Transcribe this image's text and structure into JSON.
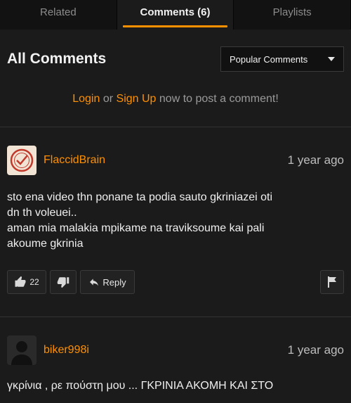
{
  "tabs": [
    {
      "label": "Related",
      "active": false
    },
    {
      "label": "Comments (6)",
      "active": true
    },
    {
      "label": "Playlists",
      "active": false
    }
  ],
  "header": {
    "title": "All Comments",
    "sort_label": "Popular Comments"
  },
  "login_prompt": {
    "login": "Login",
    "or": "or",
    "signup": "Sign Up",
    "rest": "now to post a comment!"
  },
  "comments": [
    {
      "username": "FlaccidBrain",
      "age": "1 year ago",
      "lines": [
        "sto ena video thn ponane ta podia sauto gkriniazei oti",
        "dn th voleuei..",
        "aman mia malakia mpikame na traviksoume kai pali",
        "akoume gkrinia"
      ],
      "likes": "22",
      "reply_label": "Reply"
    },
    {
      "username": "biker998i",
      "age": "1 year ago",
      "lines": [
        "γκρίνια , ρε πούστη μου ... ΓΚΡΙΝΙΑ ΑΚΟΜΗ ΚΑΙ ΣΤΟ"
      ]
    }
  ],
  "colors": {
    "accent": "#ff9000",
    "background": "#1b1b1b"
  },
  "icons": [
    "thumbs-up-icon",
    "thumbs-down-icon",
    "reply-arrow-icon",
    "flag-icon",
    "caret-down-icon"
  ]
}
